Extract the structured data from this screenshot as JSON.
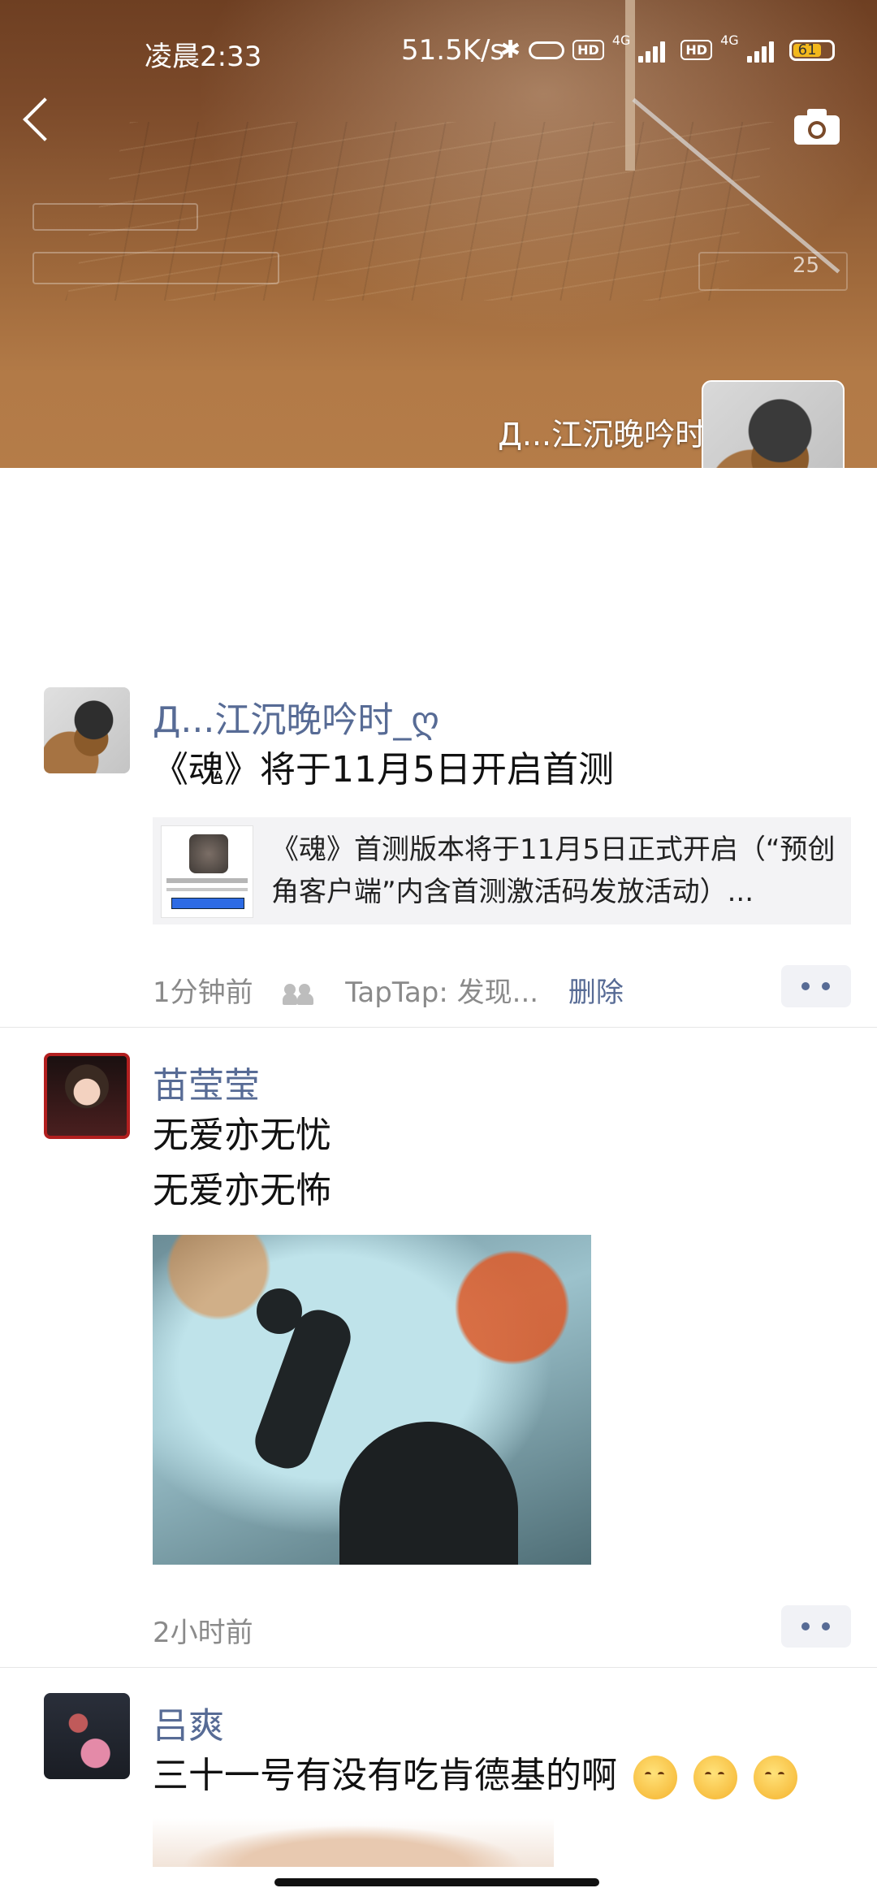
{
  "status_bar": {
    "time": "凌晨2:33",
    "net_speed": "51.5K/s",
    "hd1": "HD",
    "net1": "4G",
    "hd2": "HD",
    "net2": "4G",
    "battery": "61"
  },
  "cover": {
    "hud_ammo": "25",
    "user_name": "Д...江沉晚吟时_ღ"
  },
  "posts": [
    {
      "name": "Д...江沉晚吟时_ღ",
      "text": "《魂》将于11月5日开启首测",
      "link_text": "《魂》首测版本将于11月5日正式开启（“预创角客户端”内含首测激活码发放活动）...",
      "time": "1分钟前",
      "source": "TapTap: 发现...",
      "delete_label": "删除"
    },
    {
      "name": "苗莹莹",
      "line1": "无爱亦无忧",
      "line2": "无爱亦无怖",
      "time": "2小时前"
    },
    {
      "name": "吕爽",
      "text": "三十一号有没有吃肯德基的啊"
    }
  ],
  "icons": {
    "back": "chevron-left-icon",
    "camera": "camera-icon",
    "more": "more-dots-icon",
    "friends": "friends-visibility-icon",
    "emoji": "smiling-face-emoji"
  },
  "colors": {
    "link_blue": "#576b95",
    "cover_brown": "#a06a3c"
  }
}
